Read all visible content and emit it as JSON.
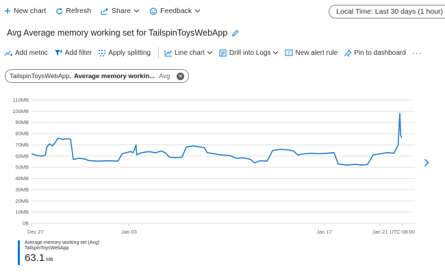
{
  "topbar": {
    "new_chart": "New chart",
    "refresh": "Refresh",
    "share": "Share",
    "feedback": "Feedback",
    "time_range": "Local Time: Last 30 days (1 hour)"
  },
  "title": "Avg Average memory working set for TailspinToysWebApp",
  "toolbar": {
    "add_metric": "Add metric",
    "add_filter": "Add filter",
    "apply_splitting": "Apply splitting",
    "line_chart": "Line chart",
    "drill_logs": "Drill into Logs",
    "new_alert": "New alert rule",
    "pin": "Pin to dashboard",
    "more": "···"
  },
  "metric_pill": {
    "resource": "TailspinToysWebApp",
    "metric": "Average memory workin...",
    "aggregation": "Avg"
  },
  "colors": {
    "accent": "#0078d4",
    "series": "#1f7bc9",
    "grid": "#e1dfdd"
  },
  "icons": [
    "plus-icon",
    "refresh-icon",
    "share-icon",
    "feedback-icon",
    "pencil-icon",
    "add-metric-icon",
    "filter-icon",
    "splitting-icon",
    "line-chart-icon",
    "logs-icon",
    "alert-icon",
    "pin-icon",
    "chevron-down-icon",
    "close-icon",
    "chevron-right-icon"
  ],
  "chart_data": {
    "type": "line",
    "title": "",
    "xlabel": "",
    "ylabel": "",
    "ylim": [
      0,
      110
    ],
    "y_ticks": [
      "110MB",
      "100MB",
      "90MB",
      "80MB",
      "70MB",
      "60MB",
      "50MB",
      "40MB",
      "30MB",
      "20MB",
      "10MB",
      "0B"
    ],
    "x_ticks": [
      {
        "day": 0,
        "label": "Dec 27"
      },
      {
        "day": 7,
        "label": "Jan 03"
      },
      {
        "day": 21,
        "label": "Jan 17"
      },
      {
        "day": 25,
        "label": "Jan 21"
      },
      {
        "day": 26.6,
        "label": "UTC-08:00"
      }
    ],
    "x_range": [
      0,
      27.5
    ],
    "grid": true,
    "legend": "bottom-left",
    "series": [
      {
        "name": "Average memory working set (Avg) TailspinToysWebApp",
        "summary_value": "63.1",
        "summary_unit": "MB",
        "points": [
          [
            0.0,
            62
          ],
          [
            0.4,
            60.5
          ],
          [
            0.8,
            60
          ],
          [
            1.0,
            61
          ],
          [
            1.1,
            68
          ],
          [
            1.3,
            71
          ],
          [
            1.5,
            69
          ],
          [
            1.7,
            72
          ],
          [
            1.9,
            76
          ],
          [
            2.2,
            75
          ],
          [
            2.6,
            75.5
          ],
          [
            2.8,
            75
          ],
          [
            3.0,
            57
          ],
          [
            3.4,
            58
          ],
          [
            3.8,
            57.5
          ],
          [
            4.1,
            56
          ],
          [
            4.8,
            55.5
          ],
          [
            5.5,
            55.8
          ],
          [
            6.2,
            55.5
          ],
          [
            6.5,
            62
          ],
          [
            6.8,
            63
          ],
          [
            7.1,
            64
          ],
          [
            7.3,
            63
          ],
          [
            7.5,
            70
          ],
          [
            7.55,
            61
          ],
          [
            7.9,
            63
          ],
          [
            8.4,
            64
          ],
          [
            8.9,
            63
          ],
          [
            9.3,
            64.5
          ],
          [
            9.6,
            63
          ],
          [
            9.9,
            59
          ],
          [
            10.3,
            58.5
          ],
          [
            10.8,
            59
          ],
          [
            11.1,
            68
          ],
          [
            11.6,
            69
          ],
          [
            12.1,
            68
          ],
          [
            12.4,
            67.5
          ],
          [
            12.6,
            63
          ],
          [
            13.1,
            62
          ],
          [
            13.6,
            61
          ],
          [
            14.2,
            60.5
          ],
          [
            14.7,
            58
          ],
          [
            15.2,
            58.5
          ],
          [
            15.7,
            57
          ],
          [
            16.0,
            54
          ],
          [
            16.4,
            55.8
          ],
          [
            16.9,
            55.5
          ],
          [
            17.3,
            65
          ],
          [
            17.9,
            66
          ],
          [
            18.4,
            65.5
          ],
          [
            18.8,
            64.5
          ],
          [
            19.1,
            61
          ],
          [
            19.6,
            62
          ],
          [
            20.1,
            62.5
          ],
          [
            20.6,
            62
          ],
          [
            21.2,
            62.5
          ],
          [
            21.7,
            63
          ],
          [
            22.0,
            53
          ],
          [
            22.6,
            52
          ],
          [
            23.2,
            52.5
          ],
          [
            23.8,
            52
          ],
          [
            24.1,
            52.5
          ],
          [
            24.5,
            61
          ],
          [
            25.0,
            62
          ],
          [
            25.5,
            63
          ],
          [
            26.0,
            62.5
          ],
          [
            26.1,
            65
          ],
          [
            26.3,
            70
          ],
          [
            26.35,
            82
          ],
          [
            26.42,
            98
          ],
          [
            26.48,
            79
          ],
          [
            26.55,
            76
          ]
        ]
      }
    ]
  },
  "legend": {
    "line1": "Average memory working set (Avg)",
    "line2": "TailspinToysWebApp",
    "value": "63.1",
    "unit": "MB"
  }
}
